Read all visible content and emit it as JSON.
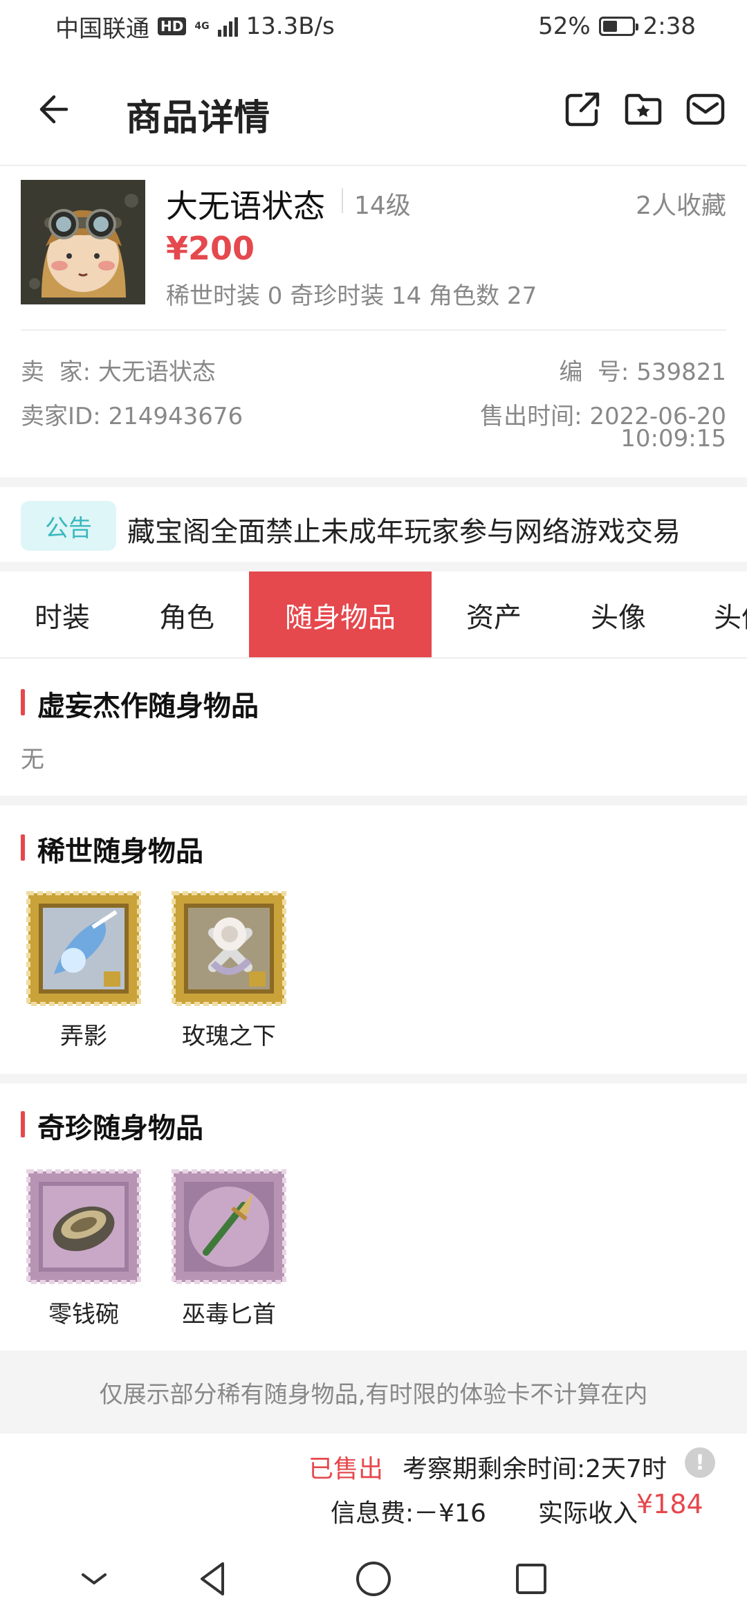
{
  "status_bar": {
    "carrier": "中国联通",
    "hd": "HD",
    "net_type": "4G",
    "speed": "13.3B/s",
    "battery_percent": "52%",
    "battery_level": 0.52,
    "time": "2:38"
  },
  "header": {
    "title": "商品详情",
    "icons": [
      "back-arrow-icon",
      "share-icon",
      "favorite-folder-icon",
      "message-icon"
    ]
  },
  "product": {
    "name": "大无语状态",
    "level": "14级",
    "favorites": "2人收藏",
    "price": "¥200",
    "stats": "稀世时装 0 奇珍时装 14 角色数 27",
    "seller_label": "卖  家:",
    "seller_value": "大无语状态",
    "seller_id_label": "卖家ID:",
    "seller_id_value": "214943676",
    "number_label": "编  号:",
    "number_value": "539821",
    "sold_time_label": "售出时间:",
    "sold_time_date": "2022-06-20",
    "sold_time_clock": "10:09:15"
  },
  "notice": {
    "tag": "公告",
    "text": "藏宝阁全面禁止未成年玩家参与网络游戏交易"
  },
  "tabs": [
    "时装",
    "角色",
    "随身物品",
    "资产",
    "头像",
    "头像框"
  ],
  "active_tab": "随身物品",
  "sections": {
    "masterpiece": {
      "title": "虚妄杰作随身物品",
      "empty_text": "无"
    },
    "rare": {
      "title": "稀世随身物品",
      "items": [
        "弄影",
        "玫瑰之下"
      ]
    },
    "precious": {
      "title": "奇珍随身物品",
      "items": [
        "零钱碗",
        "巫毒匕首"
      ]
    }
  },
  "footer_note": "仅展示部分稀有随身物品,有时限的体验卡不计算在内",
  "bottom": {
    "status": "已售出",
    "remaining": "考察期剩余时间:2天7时",
    "info_icon": "!",
    "fee": "信息费:－¥16",
    "income_label": "实际收入",
    "income_value": "¥184"
  },
  "colors": {
    "accent": "#e5484d",
    "notice_tag_bg": "#def6f7",
    "notice_tag_text": "#3ab7bf",
    "rare_stamp": "#c9a23a",
    "precious_stamp": "#b894b4"
  }
}
